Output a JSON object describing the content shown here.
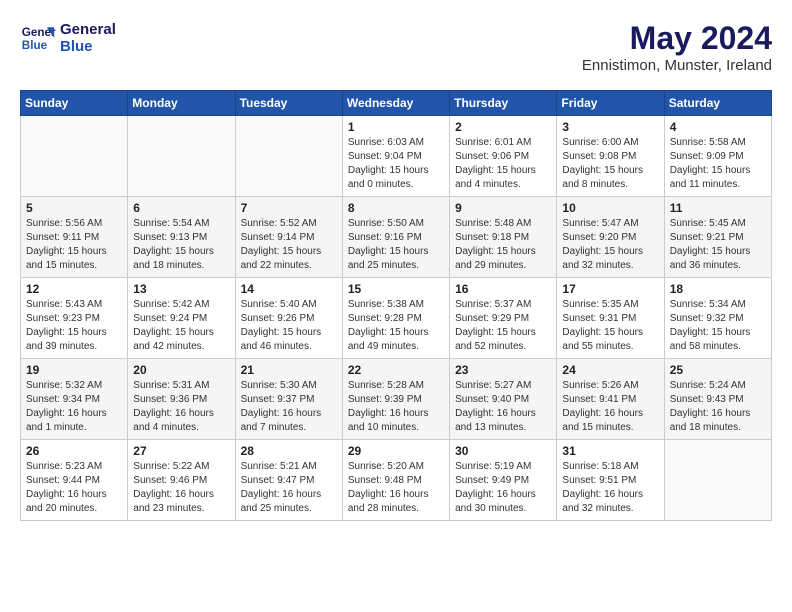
{
  "header": {
    "logo_line1": "General",
    "logo_line2": "Blue",
    "month_title": "May 2024",
    "subtitle": "Ennistimon, Munster, Ireland"
  },
  "days_of_week": [
    "Sunday",
    "Monday",
    "Tuesday",
    "Wednesday",
    "Thursday",
    "Friday",
    "Saturday"
  ],
  "weeks": [
    [
      {
        "day": "",
        "info": ""
      },
      {
        "day": "",
        "info": ""
      },
      {
        "day": "",
        "info": ""
      },
      {
        "day": "1",
        "info": "Sunrise: 6:03 AM\nSunset: 9:04 PM\nDaylight: 15 hours\nand 0 minutes."
      },
      {
        "day": "2",
        "info": "Sunrise: 6:01 AM\nSunset: 9:06 PM\nDaylight: 15 hours\nand 4 minutes."
      },
      {
        "day": "3",
        "info": "Sunrise: 6:00 AM\nSunset: 9:08 PM\nDaylight: 15 hours\nand 8 minutes."
      },
      {
        "day": "4",
        "info": "Sunrise: 5:58 AM\nSunset: 9:09 PM\nDaylight: 15 hours\nand 11 minutes."
      }
    ],
    [
      {
        "day": "5",
        "info": "Sunrise: 5:56 AM\nSunset: 9:11 PM\nDaylight: 15 hours\nand 15 minutes."
      },
      {
        "day": "6",
        "info": "Sunrise: 5:54 AM\nSunset: 9:13 PM\nDaylight: 15 hours\nand 18 minutes."
      },
      {
        "day": "7",
        "info": "Sunrise: 5:52 AM\nSunset: 9:14 PM\nDaylight: 15 hours\nand 22 minutes."
      },
      {
        "day": "8",
        "info": "Sunrise: 5:50 AM\nSunset: 9:16 PM\nDaylight: 15 hours\nand 25 minutes."
      },
      {
        "day": "9",
        "info": "Sunrise: 5:48 AM\nSunset: 9:18 PM\nDaylight: 15 hours\nand 29 minutes."
      },
      {
        "day": "10",
        "info": "Sunrise: 5:47 AM\nSunset: 9:20 PM\nDaylight: 15 hours\nand 32 minutes."
      },
      {
        "day": "11",
        "info": "Sunrise: 5:45 AM\nSunset: 9:21 PM\nDaylight: 15 hours\nand 36 minutes."
      }
    ],
    [
      {
        "day": "12",
        "info": "Sunrise: 5:43 AM\nSunset: 9:23 PM\nDaylight: 15 hours\nand 39 minutes."
      },
      {
        "day": "13",
        "info": "Sunrise: 5:42 AM\nSunset: 9:24 PM\nDaylight: 15 hours\nand 42 minutes."
      },
      {
        "day": "14",
        "info": "Sunrise: 5:40 AM\nSunset: 9:26 PM\nDaylight: 15 hours\nand 46 minutes."
      },
      {
        "day": "15",
        "info": "Sunrise: 5:38 AM\nSunset: 9:28 PM\nDaylight: 15 hours\nand 49 minutes."
      },
      {
        "day": "16",
        "info": "Sunrise: 5:37 AM\nSunset: 9:29 PM\nDaylight: 15 hours\nand 52 minutes."
      },
      {
        "day": "17",
        "info": "Sunrise: 5:35 AM\nSunset: 9:31 PM\nDaylight: 15 hours\nand 55 minutes."
      },
      {
        "day": "18",
        "info": "Sunrise: 5:34 AM\nSunset: 9:32 PM\nDaylight: 15 hours\nand 58 minutes."
      }
    ],
    [
      {
        "day": "19",
        "info": "Sunrise: 5:32 AM\nSunset: 9:34 PM\nDaylight: 16 hours\nand 1 minute."
      },
      {
        "day": "20",
        "info": "Sunrise: 5:31 AM\nSunset: 9:36 PM\nDaylight: 16 hours\nand 4 minutes."
      },
      {
        "day": "21",
        "info": "Sunrise: 5:30 AM\nSunset: 9:37 PM\nDaylight: 16 hours\nand 7 minutes."
      },
      {
        "day": "22",
        "info": "Sunrise: 5:28 AM\nSunset: 9:39 PM\nDaylight: 16 hours\nand 10 minutes."
      },
      {
        "day": "23",
        "info": "Sunrise: 5:27 AM\nSunset: 9:40 PM\nDaylight: 16 hours\nand 13 minutes."
      },
      {
        "day": "24",
        "info": "Sunrise: 5:26 AM\nSunset: 9:41 PM\nDaylight: 16 hours\nand 15 minutes."
      },
      {
        "day": "25",
        "info": "Sunrise: 5:24 AM\nSunset: 9:43 PM\nDaylight: 16 hours\nand 18 minutes."
      }
    ],
    [
      {
        "day": "26",
        "info": "Sunrise: 5:23 AM\nSunset: 9:44 PM\nDaylight: 16 hours\nand 20 minutes."
      },
      {
        "day": "27",
        "info": "Sunrise: 5:22 AM\nSunset: 9:46 PM\nDaylight: 16 hours\nand 23 minutes."
      },
      {
        "day": "28",
        "info": "Sunrise: 5:21 AM\nSunset: 9:47 PM\nDaylight: 16 hours\nand 25 minutes."
      },
      {
        "day": "29",
        "info": "Sunrise: 5:20 AM\nSunset: 9:48 PM\nDaylight: 16 hours\nand 28 minutes."
      },
      {
        "day": "30",
        "info": "Sunrise: 5:19 AM\nSunset: 9:49 PM\nDaylight: 16 hours\nand 30 minutes."
      },
      {
        "day": "31",
        "info": "Sunrise: 5:18 AM\nSunset: 9:51 PM\nDaylight: 16 hours\nand 32 minutes."
      },
      {
        "day": "",
        "info": ""
      }
    ]
  ]
}
